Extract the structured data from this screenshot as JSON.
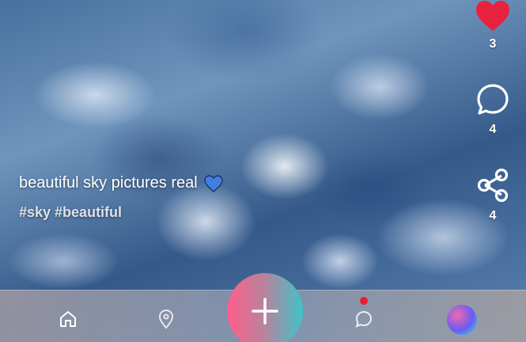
{
  "post": {
    "caption": "beautiful sky pictures real",
    "hashtags": "#sky #beautiful"
  },
  "actions": {
    "likes": "3",
    "comments": "4",
    "shares": "4"
  },
  "colors": {
    "like": "#e8213f",
    "accent_pink": "#ff5f8a",
    "accent_teal": "#3ec3c8",
    "caption_heart": "#3f7fe6"
  },
  "icons": [
    "heart-icon",
    "comment-icon",
    "share-icon",
    "home-icon",
    "map-pin-icon",
    "plus-icon",
    "chat-icon"
  ]
}
